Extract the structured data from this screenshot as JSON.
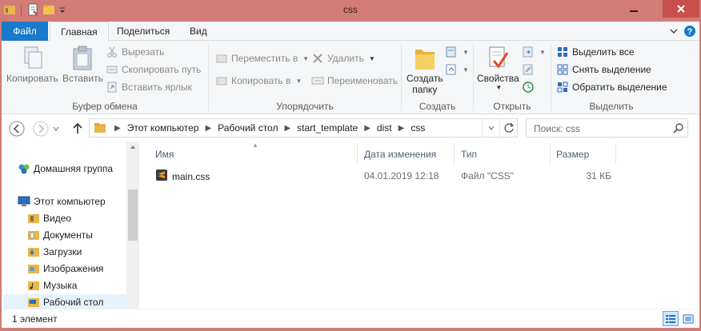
{
  "window": {
    "title": "css",
    "colors": {
      "frame": "#d37b77",
      "file_tab": "#1979ca",
      "close": "#c7504a",
      "selection": "#e5f3ff"
    }
  },
  "ribbon": {
    "tabs": [
      {
        "label": "Файл"
      },
      {
        "label": "Главная"
      },
      {
        "label": "Поделиться"
      },
      {
        "label": "Вид"
      }
    ],
    "groups": {
      "clipboard": {
        "label": "Буфер обмена",
        "copy": "Копировать",
        "paste": "Вставить",
        "cut": "Вырезать",
        "copy_path": "Скопировать путь",
        "paste_shortcut": "Вставить ярлык"
      },
      "organize": {
        "label": "Упорядочить",
        "move_to": "Переместить в",
        "copy_to": "Копировать в",
        "delete": "Удалить",
        "rename": "Переименовать"
      },
      "new": {
        "label": "Создать",
        "new_folder_line1": "Создать",
        "new_folder_line2": "папку"
      },
      "open": {
        "label": "Открыть",
        "properties": "Свойства"
      },
      "select": {
        "label": "Выделить",
        "select_all": "Выделить все",
        "select_none": "Снять выделение",
        "invert": "Обратить выделение"
      }
    }
  },
  "address": {
    "crumbs": [
      "Этот компьютер",
      "Рабочий стол",
      "start_template",
      "dist",
      "css"
    ],
    "search_placeholder": "Поиск: css"
  },
  "nav": {
    "items": [
      {
        "label": "Домашняя группа",
        "icon": "homegroup-icon"
      },
      {
        "label": "Этот компьютер",
        "icon": "computer-icon"
      },
      {
        "label": "Видео",
        "icon": "videos-folder-icon"
      },
      {
        "label": "Документы",
        "icon": "documents-folder-icon"
      },
      {
        "label": "Загрузки",
        "icon": "downloads-folder-icon"
      },
      {
        "label": "Изображения",
        "icon": "pictures-folder-icon"
      },
      {
        "label": "Музыка",
        "icon": "music-folder-icon"
      },
      {
        "label": "Рабочий стол",
        "icon": "desktop-folder-icon"
      }
    ]
  },
  "list": {
    "columns": [
      "Имя",
      "Дата изменения",
      "Тип",
      "Размер"
    ],
    "rows": [
      {
        "name": "main.css",
        "date": "04.01.2019 12:18",
        "type": "Файл \"CSS\"",
        "size": "31 КБ",
        "icon": "sublime-file-icon"
      }
    ]
  },
  "status": {
    "text": "1 элемент"
  }
}
